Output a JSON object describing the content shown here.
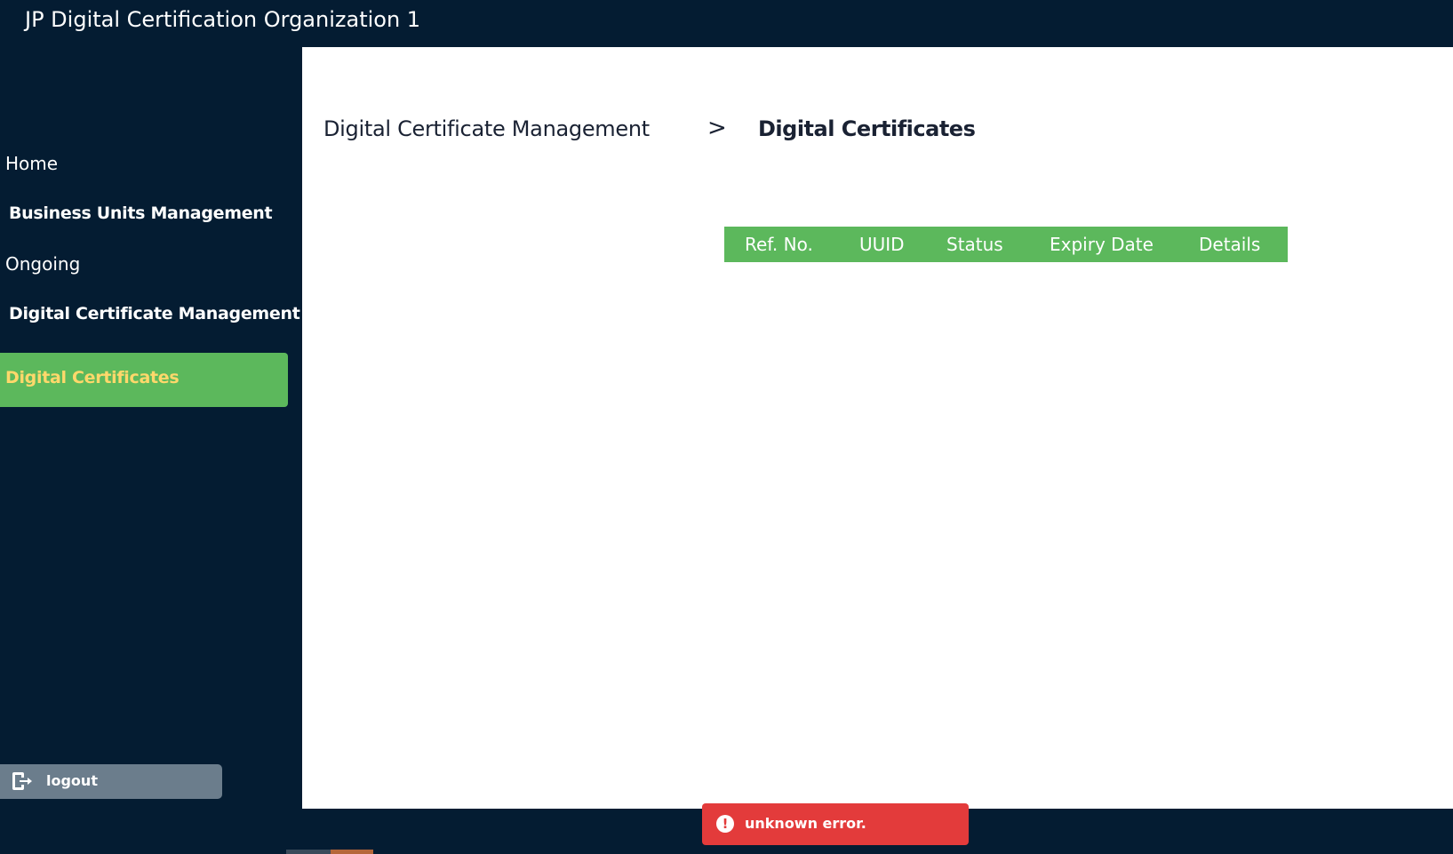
{
  "header": {
    "title": "JP Digital Certification Organization 1"
  },
  "sidebar": {
    "items": [
      {
        "label": "Home"
      },
      {
        "label": "Business Units Management"
      },
      {
        "label": "Ongoing"
      },
      {
        "label": "Digital Certificate Management"
      },
      {
        "label": "Digital Certificates"
      }
    ],
    "active_item": "Digital Certificates",
    "logout_label": "logout",
    "logout_icon": "logout-icon"
  },
  "breadcrumb": {
    "parent": "Digital Certificate Management",
    "separator": ">",
    "current": "Digital Certificates"
  },
  "table": {
    "columns": [
      "Ref. No.",
      "UUID",
      "Status",
      "Expiry Date",
      "Details"
    ],
    "rows": []
  },
  "toast": {
    "icon": "exclamation-circle-icon",
    "icon_glyph": "!",
    "message": "unknown error."
  },
  "colors": {
    "background_dark": "#041c32",
    "accent_green": "#5cb85c",
    "active_label": "#ffd86b",
    "logout_button": "#6b7d8c",
    "error_toast": "#e33b3b"
  }
}
